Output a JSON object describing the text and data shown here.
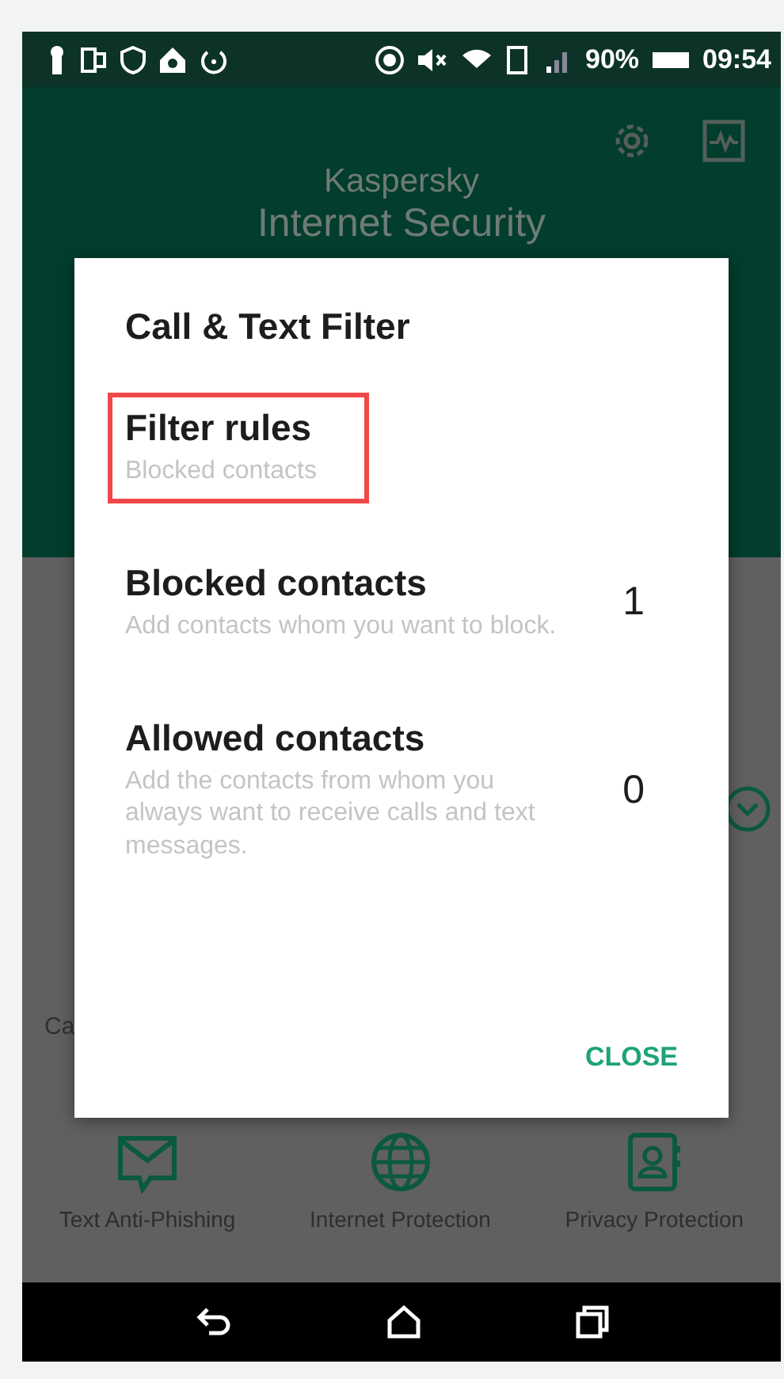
{
  "status_bar": {
    "battery": "90%",
    "time": "09:54"
  },
  "header": {
    "brand": "Kaspersky",
    "product": "Internet Security"
  },
  "background": {
    "partial_label": "Ca",
    "features": [
      {
        "kind": "message",
        "label": "Text Anti-Phishing"
      },
      {
        "kind": "globe",
        "label": "Internet Protection"
      },
      {
        "kind": "contacts",
        "label": "Privacy Protection"
      }
    ]
  },
  "dialog": {
    "title": "Call & Text Filter",
    "items": [
      {
        "title": "Filter rules",
        "subtitle": "Blocked contacts",
        "highlighted": true
      },
      {
        "title": "Blocked contacts",
        "subtitle": "Add contacts whom you want to block.",
        "count": "1",
        "highlighted": false
      },
      {
        "title": "Allowed contacts",
        "subtitle": "Add the contacts from whom you always want to receive calls and text messages.",
        "count": "0",
        "highlighted": false
      }
    ],
    "close_button": "CLOSE"
  }
}
